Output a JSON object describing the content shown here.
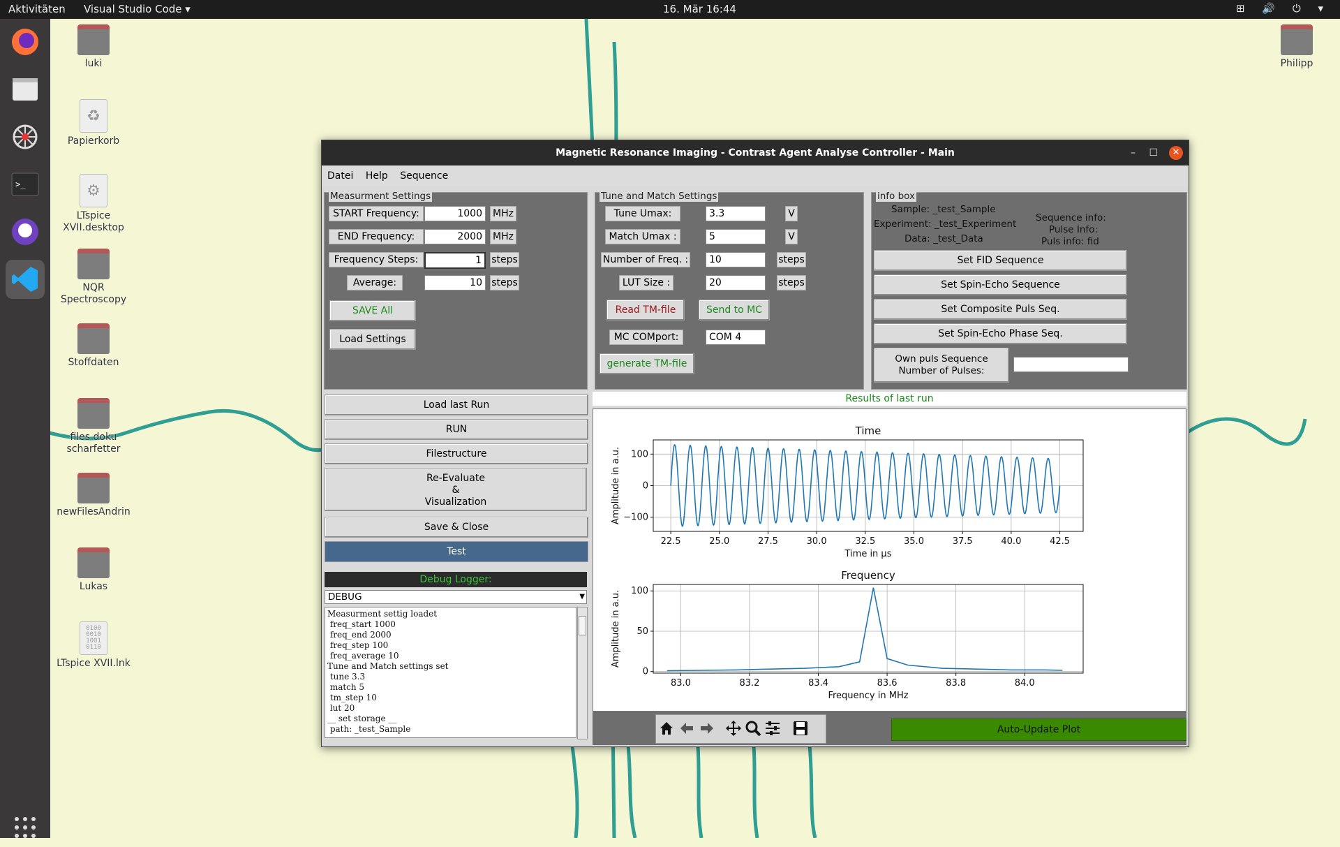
{
  "topbar": {
    "activities": "Aktivitäten",
    "app": "Visual Studio Code ▾",
    "clock": "16. Mär  16:44",
    "tray": "⊞ 🔊 ⏻ ▾"
  },
  "desktop_icons": [
    {
      "label": "luki"
    },
    {
      "label": "Papierkorb"
    },
    {
      "label": "LTspice XVII.desktop"
    },
    {
      "label": "NQR Spectroscopy"
    },
    {
      "label": "Stoffdaten"
    },
    {
      "label": "files doku scharfetter"
    },
    {
      "label": "newFilesAndrin"
    },
    {
      "label": "Lukas"
    },
    {
      "label": "LTspice XVII.lnk"
    },
    {
      "label": "Philipp"
    }
  ],
  "window": {
    "title": "Magnetic Resonance Imaging - Contrast Agent Analyse Controller - Main",
    "menu": [
      "Datei",
      "Help",
      "Sequence"
    ]
  },
  "measurement": {
    "title": "Measurment Settings",
    "start_label": "START Frequency:",
    "start_value": "1000",
    "start_unit": "MHz",
    "end_label": "END Frequency:",
    "end_value": "2000",
    "end_unit": "MHz",
    "steps_label": "Frequency Steps:",
    "steps_value": "1",
    "steps_unit": "steps",
    "avg_label": "Average:",
    "avg_value": "10",
    "avg_unit": "steps",
    "save_btn": "SAVE All",
    "load_btn": "Load Settings"
  },
  "tune": {
    "title": "Tune and Match Settings",
    "tune_label": "Tune Umax:",
    "tune_value": "3.3",
    "tune_unit": "V",
    "match_label": "Match Umax  :",
    "match_value": "5",
    "match_unit": "V",
    "nfreq_label": "Number of Freq. :",
    "nfreq_value": "10",
    "nfreq_unit": "steps",
    "lut_label": "LUT Size :",
    "lut_value": "20",
    "lut_unit": "steps",
    "read_btn": "Read TM-file",
    "send_btn": "Send to MC",
    "com_label": "MC COMport:",
    "com_value": "COM 4",
    "gen_btn": "generate TM-file"
  },
  "info": {
    "title": "info box",
    "sample": "Sample: _test_Sample",
    "experiment": "Experiment: _test_Experiment",
    "data": "Data: _test_Data",
    "seq_info": "Sequence info:",
    "pulse_info": "Pulse Info:",
    "puls_info": "Puls info: fid",
    "btn_fid": "Set FID Sequence",
    "btn_spin": "Set Spin-Echo Sequence",
    "btn_comp": "Set Composite Puls Seq.",
    "btn_phase": "Set Spin-Echo Phase Seq.",
    "own_line1": "Own puls Sequence",
    "own_line2": "Number of Pulses:",
    "own_value": ""
  },
  "actions": {
    "load_last": "Load last Run",
    "run": "RUN",
    "files": "Filestructure",
    "reeval1": "Re-Evaluate",
    "reeval2": "&",
    "reeval3": "Visualization",
    "save_close": "Save & Close",
    "test": "Test"
  },
  "debug": {
    "title": "Debug Logger:",
    "level": "DEBUG",
    "lines": [
      "Measurment settig loadet",
      " freq_start 1000",
      " freq_end 2000",
      " freq_step 100",
      " freq_average 10",
      "Tune and Match settings set",
      " tune 3.3",
      " match 5",
      " tm_step 10",
      " lut 20",
      "__ set storage __",
      " path: _test_Sample"
    ]
  },
  "results": {
    "title": "Results of last run",
    "auto_update": "Auto-Update Plot"
  },
  "chart_data": [
    {
      "type": "line",
      "title": "Time",
      "xlabel": "Time in µs",
      "ylabel": "Amplitude in a.u.",
      "xlim": [
        21.6,
        43.7
      ],
      "ylim": [
        -145,
        145
      ],
      "xticks": [
        "22.5",
        "25.0",
        "27.5",
        "30.0",
        "32.5",
        "35.0",
        "37.5",
        "40.0",
        "42.5"
      ],
      "yticks": [
        "100",
        "0",
        "−100"
      ],
      "series": [
        {
          "x_start": 22.5,
          "x_end": 42.5,
          "amplitude_start": 130,
          "amplitude_end": 85,
          "cycles": 25,
          "color": "#1f77b4"
        }
      ]
    },
    {
      "type": "line",
      "title": "Frequency",
      "xlabel": "Frequency in MHz",
      "ylabel": "Amplitude in a.u.",
      "xlim": [
        82.92,
        84.17
      ],
      "ylim": [
        -2,
        108
      ],
      "xticks": [
        "83.0",
        "83.2",
        "83.4",
        "83.6",
        "83.8",
        "84.0"
      ],
      "yticks": [
        "100",
        "50",
        "0"
      ],
      "series": [
        {
          "x": [
            82.96,
            83.06,
            83.16,
            83.26,
            83.36,
            83.46,
            83.52,
            83.56,
            83.6,
            83.66,
            83.76,
            83.86,
            83.96,
            84.06,
            84.11
          ],
          "y": [
            1,
            1.5,
            2,
            3,
            4,
            6,
            12,
            104,
            16,
            8,
            4,
            3,
            2,
            2,
            1.5
          ],
          "color": "#1f77b4"
        }
      ]
    }
  ]
}
